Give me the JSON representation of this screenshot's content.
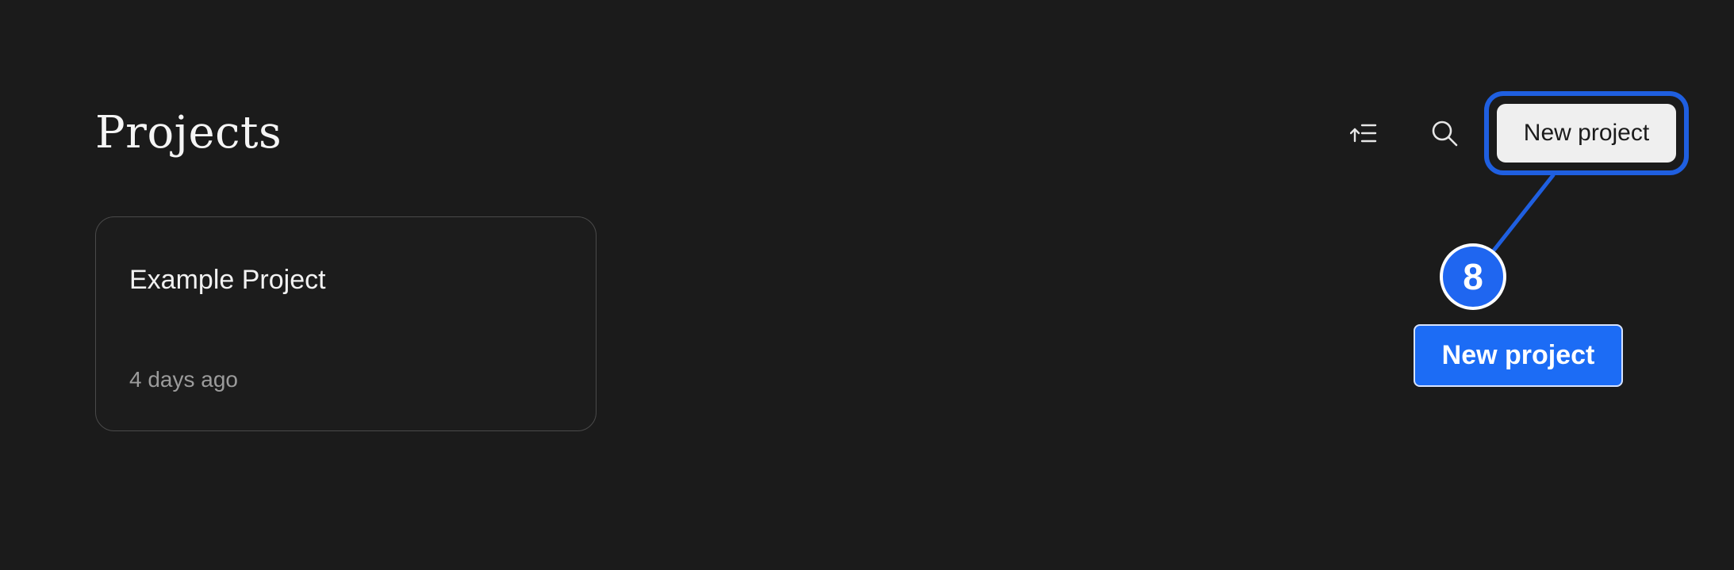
{
  "header": {
    "title": "Projects",
    "sort_icon": "sort-ascending-icon",
    "search_icon": "search-icon",
    "new_project_label": "New project"
  },
  "projects": [
    {
      "name": "Example Project",
      "updated": "4 days ago"
    }
  ],
  "annotation": {
    "step_number": "8",
    "step_label": "New project",
    "accent_color": "#1f66f0"
  },
  "colors": {
    "background": "#1b1b1b",
    "button_bg": "#efefef",
    "card_border": "#4a4a4a"
  }
}
